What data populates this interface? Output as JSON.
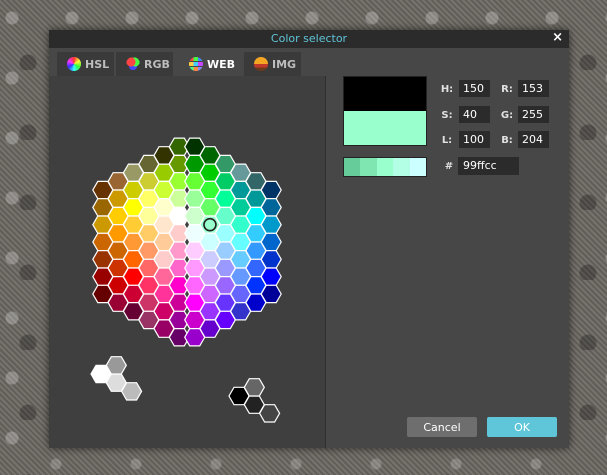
{
  "dialog": {
    "title": "Color selector",
    "close_glyph": "×"
  },
  "tabs": [
    {
      "label": "HSL",
      "icon": "hsl-wheel-icon",
      "active": false
    },
    {
      "label": "RGB",
      "icon": "rgb-circles-icon",
      "active": false
    },
    {
      "label": "WEB",
      "icon": "web-palette-icon",
      "active": true
    },
    {
      "label": "IMG",
      "icon": "image-icon",
      "active": false
    }
  ],
  "preview": {
    "previous_color": "#000000",
    "new_color": "#99ffcc"
  },
  "shades": [
    "#66cc99",
    "#7fe6b2",
    "#99ffcc",
    "#b3ffe6",
    "#ccffff"
  ],
  "fields": {
    "h": {
      "label": "H:",
      "value": "150"
    },
    "s": {
      "label": "S:",
      "value": "40"
    },
    "l": {
      "label": "L:",
      "value": "100"
    },
    "r": {
      "label": "R:",
      "value": "153"
    },
    "g": {
      "label": "G:",
      "value": "255"
    },
    "b": {
      "label": "B:",
      "value": "204"
    }
  },
  "hex": {
    "label": "#",
    "value": "99ffcc"
  },
  "buttons": {
    "cancel": "Cancel",
    "ok": "OK"
  },
  "colors": {
    "accent": "#5fc6d9",
    "titlebar": "#2b2b2b",
    "panel": "#474747"
  },
  "palette": {
    "selected": "#99ffcc",
    "selected_marker": "ring",
    "main_grid_columns": [
      [
        "#663300",
        "#996600",
        "#cc9900",
        "#cc6600",
        "#993300",
        "#990000",
        "#660000"
      ],
      [
        "#996633",
        "#cc9900",
        "#ffcc00",
        "#ff9900",
        "#cc6600",
        "#cc3300",
        "#cc0000",
        "#990033"
      ],
      [
        "#999966",
        "#cccc00",
        "#ffff00",
        "#ffcc33",
        "#ff9933",
        "#ff6600",
        "#ff0000",
        "#cc0033",
        "#660033"
      ],
      [
        "#666633",
        "#cccc33",
        "#ffff66",
        "#ffff99",
        "#ffcc66",
        "#ff9966",
        "#ff6666",
        "#ff3366",
        "#cc3366",
        "#993366"
      ],
      [
        "#333300",
        "#99cc00",
        "#ccff33",
        "#ffffcc",
        "#ffe6cc",
        "#ffcc99",
        "#ffcccc",
        "#ff6699",
        "#ff3399",
        "#cc0066",
        "#990066"
      ],
      [
        "#336600",
        "#669900",
        "#99ff33",
        "#ccff99",
        "#ffffff",
        "#ffcccc",
        "#ff99cc",
        "#ff66cc",
        "#ff00cc",
        "#cc0099",
        "#990099",
        "#660066"
      ],
      [
        "#003300",
        "#009900",
        "#66ff33",
        "#99ff99",
        "#ccffcc",
        "#eeffff",
        "#ffccff",
        "#ff99ff",
        "#ff66ff",
        "#ff00ff",
        "#cc00cc",
        "#9900cc"
      ],
      [
        "#006600",
        "#00cc00",
        "#33ff33",
        "#66ff66",
        "#99ffcc",
        "#ccffff",
        "#ccccff",
        "#cc99ff",
        "#cc66ff",
        "#9933ff",
        "#6600cc"
      ],
      [
        "#339966",
        "#00cc66",
        "#00ff99",
        "#66ffcc",
        "#99ffff",
        "#99ccff",
        "#9999ff",
        "#9966ff",
        "#6633ff",
        "#6600ff"
      ],
      [
        "#669999",
        "#009999",
        "#00cc99",
        "#33ffcc",
        "#66ffff",
        "#66ccff",
        "#6699ff",
        "#6666ff",
        "#3333cc"
      ],
      [
        "#336666",
        "#009999",
        "#00ffff",
        "#33ccff",
        "#3399ff",
        "#3366ff",
        "#0033ff",
        "#0000cc"
      ],
      [
        "#003366",
        "#006699",
        "#0099cc",
        "#0066cc",
        "#0033cc",
        "#0000ff",
        "#000099"
      ]
    ],
    "gray_cluster_light": [
      "#ffffff",
      "#dddddd",
      "#bbbbbb",
      "#999999"
    ],
    "gray_cluster_dark": [
      "#000000",
      "#222222",
      "#444444",
      "#666666"
    ]
  }
}
